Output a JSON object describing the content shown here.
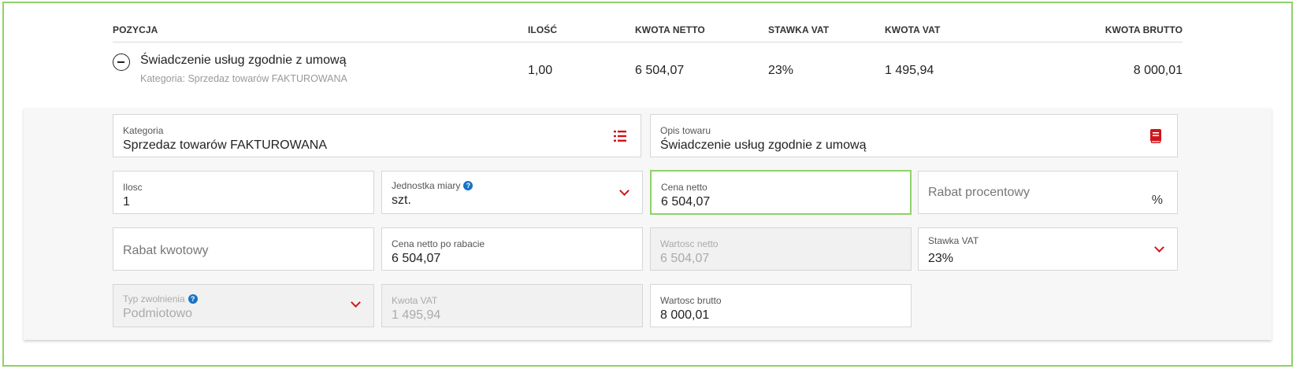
{
  "table": {
    "headers": {
      "position": "POZYCJA",
      "quantity": "ILOŚĆ",
      "net_amount": "KWOTA NETTO",
      "vat_rate": "STAWKA VAT",
      "vat_amount": "KWOTA VAT",
      "gross_amount": "KWOTA BRUTTO"
    },
    "row": {
      "name": "Świadczenie usług zgodnie z umową",
      "category": "Kategoria: Sprzedaz towarów FAKTUROWANA",
      "quantity": "1,00",
      "net_amount": "6 504,07",
      "vat_rate": "23%",
      "vat_amount": "1 495,94",
      "gross_amount": "8 000,01"
    }
  },
  "form": {
    "kategoria": {
      "label": "Kategoria",
      "value": "Sprzedaz towarów FAKTUROWANA",
      "icon": "list-icon"
    },
    "opis": {
      "label": "Opis towaru",
      "value": "Świadczenie usług zgodnie z umową",
      "icon": "book-icon"
    },
    "ilosc": {
      "label": "Ilosc",
      "value": "1"
    },
    "jednostka": {
      "label": "Jednostka miary",
      "value": "szt.",
      "help": "?"
    },
    "cena_netto": {
      "label": "Cena netto",
      "value": "6 504,07"
    },
    "rabat_procentowy": {
      "placeholder": "Rabat procentowy",
      "suffix": "%"
    },
    "rabat_kwotowy": {
      "placeholder": "Rabat kwotowy"
    },
    "cena_po_rabacie": {
      "label": "Cena netto po rabacie",
      "value": "6 504,07"
    },
    "wartosc_netto": {
      "label": "Wartosc netto",
      "value": "6 504,07"
    },
    "stawka_vat": {
      "label": "Stawka VAT",
      "value": "23%"
    },
    "typ_zwolnienia": {
      "label": "Typ zwolnienia",
      "value": "Podmiotowo",
      "help": "?"
    },
    "kwota_vat": {
      "label": "Kwota VAT",
      "value": "1 495,94"
    },
    "wartosc_brutto": {
      "label": "Wartosc brutto",
      "value": "8 000,01"
    }
  },
  "colors": {
    "accent_green": "#8fd16a",
    "icon_red": "#d0141a",
    "help_blue": "#1a73c4"
  }
}
